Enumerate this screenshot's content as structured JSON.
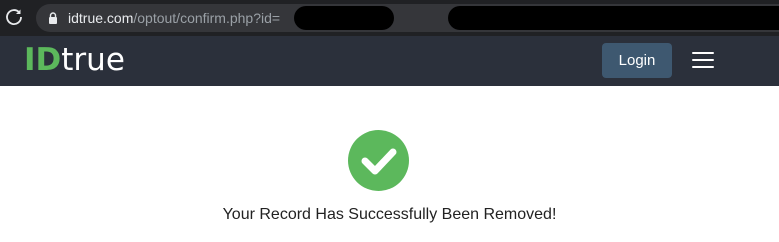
{
  "browser": {
    "url_host": "idtrue.com",
    "url_path": "/optout/confirm.php?id=",
    "reload_icon": "reload-icon",
    "lock_icon": "lock-icon"
  },
  "navbar": {
    "brand_id": "ID",
    "brand_rest": "true",
    "login_label": "Login",
    "menu_icon": "hamburger-menu-icon"
  },
  "content": {
    "status_icon": "checkmark-circle-icon",
    "message": "Your Record Has Successfully Been Removed!"
  },
  "colors": {
    "navbar_bg": "#2b303b",
    "brand_green": "#5cb85c",
    "login_bg": "#3e5870",
    "success_green": "#5cb85c"
  }
}
